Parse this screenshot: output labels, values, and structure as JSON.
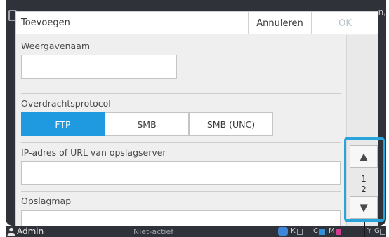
{
  "dialog": {
    "title": "Toevoegen",
    "cancel_label": "Annuleren",
    "ok_label": "OK"
  },
  "fields": {
    "display_name": {
      "label": "Weergavenaam",
      "value": ""
    },
    "protocol": {
      "label": "Overdrachtsprotocol",
      "options": [
        "FTP",
        "SMB",
        "SMB (UNC)"
      ],
      "selected": "FTP"
    },
    "server": {
      "label": "IP-adres of URL van opslagserver",
      "value": ""
    },
    "folder": {
      "label": "Opslagmap",
      "value": ""
    }
  },
  "pager": {
    "current_page": "1",
    "total_pages": "2",
    "up_glyph": "▲",
    "down_glyph": "▼"
  },
  "status_bar": {
    "user": "Admin",
    "status": "Niet-actief",
    "ink_labels": [
      "K",
      "C",
      "M",
      "Y",
      "G"
    ]
  },
  "screen_edge": {
    "right_fragment": "n,"
  },
  "colors": {
    "accent": "#1f9ae0",
    "highlight": "#27a4dc",
    "ok_disabled": "#b8c4cc",
    "status_bar_bg": "#2f3238"
  },
  "icons": {
    "user": "user-icon",
    "ink": "ink-drop-icon",
    "scroll_up": "triangle-up-icon",
    "scroll_down": "triangle-down-icon"
  }
}
